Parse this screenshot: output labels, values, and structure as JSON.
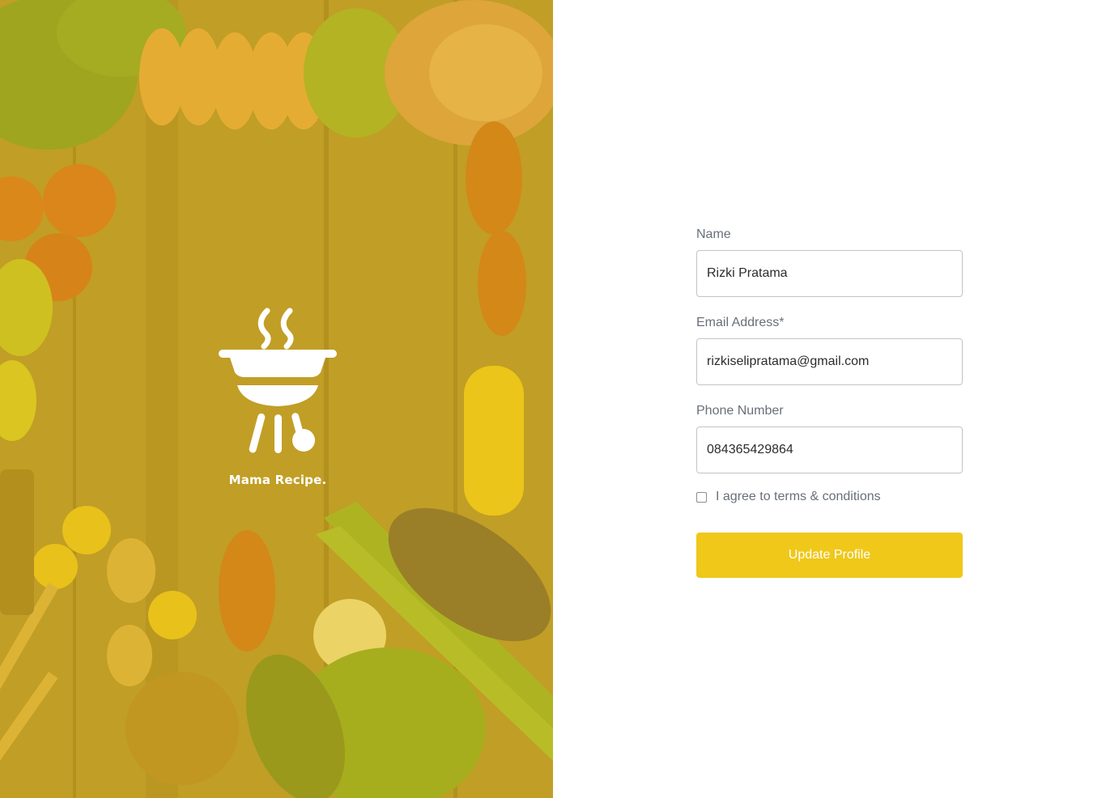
{
  "brand": {
    "name": "Mama Recipe.",
    "logo_icon": "grill-icon"
  },
  "hero": {
    "image": "food-ingredients-background"
  },
  "form": {
    "name": {
      "label": "Name",
      "value": "Rizki Pratama"
    },
    "email": {
      "label": "Email Address*",
      "value": "rizkiselipratama@gmail.com"
    },
    "phone": {
      "label": "Phone Number",
      "value": "084365429864"
    },
    "terms": {
      "label": "I agree to terms & conditions",
      "checked": false
    },
    "submit_label": "Update Profile"
  },
  "colors": {
    "accent": "#EFC81A",
    "label": "#696F79",
    "input_border": "#C4C4C4"
  }
}
